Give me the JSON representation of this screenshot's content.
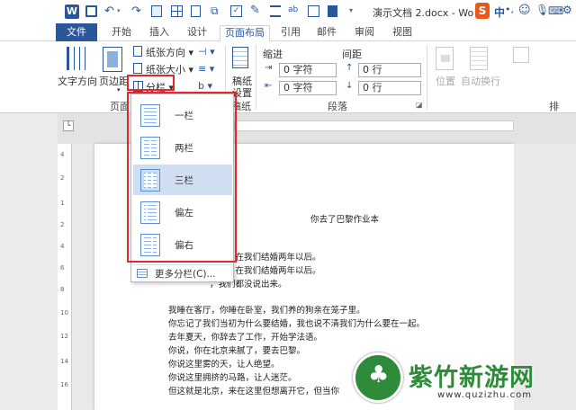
{
  "titlebar": {
    "title": "演示文档 2.docx - Wo",
    "app_letter": "W",
    "ime_label": "中",
    "ime_dot": "•,"
  },
  "tabs": [
    "文件",
    "开始",
    "插入",
    "设计",
    "页面布局",
    "引用",
    "邮件",
    "审阅",
    "视图"
  ],
  "active_tab": "页面布局",
  "ribbon": {
    "text_direction": "文字方向",
    "margins": "页边距",
    "orientation": "纸张方向",
    "size": "纸张大小",
    "columns": "分栏",
    "page_setup_partial": "页面",
    "draft_paper_top": "稿纸",
    "draft_paper_bottom": "设置",
    "draft_group": "稿纸",
    "indent_label": "缩进",
    "spacing_label": "间距",
    "indent_left": "0 字符",
    "indent_right": "0 字符",
    "spacing_before": "0 行",
    "spacing_after": "0 行",
    "paragraph_group": "段落",
    "position": "位置",
    "wrap_text": "自动换行",
    "arrange_partial": "排"
  },
  "columns_menu": {
    "items": [
      "一栏",
      "两栏",
      "三栏",
      "偏左",
      "偏右"
    ],
    "selected": "三栏",
    "more": "更多分栏(C)..."
  },
  "document": {
    "title": "你去了巴黎作业本",
    "lines": [
      "你了，在我们结婚两年以后。",
      "我了，在我们结婚两年以后。",
      "，我们都没说出来。",
      "我睡在客厅，你睡在卧室，我们养的狗亲在笼子里。",
      "你忘记了我们当初为什么要结婚，我也说不清我们为什么要在一起。",
      "去年夏天，你辞去了工作，开始学法语。",
      "你说，你在北京来腻了，要去巴黎。",
      "你说这里雾的天，让人绝望。",
      "你说这里拥挤的马路，让人迷茫。",
      "但这就是北京，来在这里但想离开它，但当你"
    ]
  },
  "ruler_numbers": [
    "4",
    "2",
    "1",
    "2",
    "4",
    "6",
    "8",
    "10",
    "12",
    "14",
    "16"
  ],
  "watermark": {
    "name": "紫竹新游网",
    "url": "www.quzizhu.com"
  },
  "colors": {
    "accent": "#2b579a",
    "highlight": "#cfdff1",
    "red_frame": "#e0282e",
    "watermark_green": "#2e8b3a"
  }
}
